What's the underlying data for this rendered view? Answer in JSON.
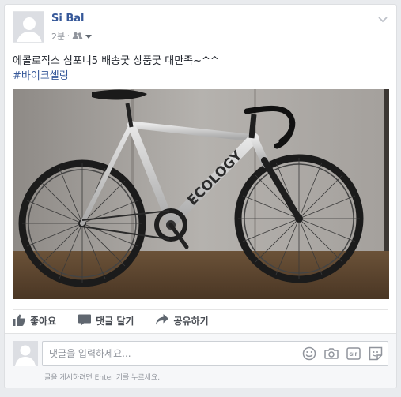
{
  "post": {
    "author": "Si Bal",
    "time": "2분",
    "text": "에콜로직스 심포니5 배송굿 상품굿 대만족~^^",
    "hashtag": "#바이크셀링"
  },
  "photo": {
    "frame_brand": "ECOLOGY"
  },
  "actions": {
    "like": "좋아요",
    "comment": "댓글 달기",
    "share": "공유하기"
  },
  "composer": {
    "placeholder": "댓글을 입력하세요...",
    "hint": "글을 게시하려면 Enter 키를 누르세요.",
    "gif_label": "GIF"
  },
  "icons": {
    "audience": "friends-icon",
    "menu": "chevron-down-icon",
    "like": "thumbs-up-icon",
    "comment": "speech-bubble-icon",
    "share": "share-arrow-icon",
    "emoji": "smiley-icon",
    "camera": "camera-icon",
    "gif": "gif-icon",
    "sticker": "sticker-icon"
  },
  "colors": {
    "link": "#365899",
    "muted": "#90949c",
    "action_text": "#4b4f56",
    "background": "#e9ebee"
  }
}
